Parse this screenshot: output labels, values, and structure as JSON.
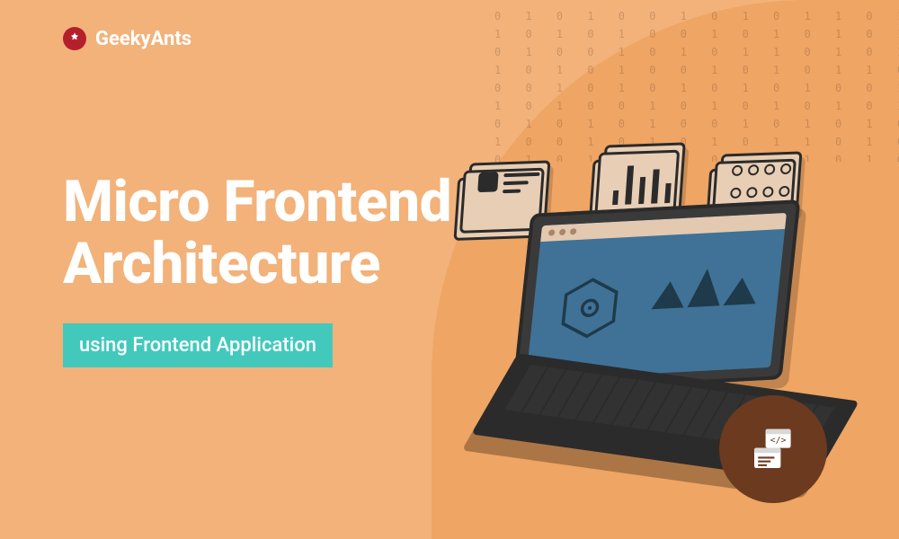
{
  "brand": {
    "name": "GeekyAnts"
  },
  "hero": {
    "title_line1": "Micro Frontend",
    "title_line2": "Architecture",
    "subtitle": "using Frontend Application"
  },
  "colors": {
    "bg_primary": "#f2b27a",
    "bg_secondary": "#efa563",
    "accent_pill": "#42c9bc",
    "brand_red": "#b3202b",
    "text_white": "#ffffff",
    "badge_brown": "#6b3a1f"
  },
  "decor": {
    "binary_pattern": "0 1 0 1 0 0 1 0 1 0 1 1 0 1 0 1 0 0 1 1 0 1\n1 0 1 0 1 0 0 1 0 1 0 1 0 1 0 0 1 0 1 0 1 0\n0 1 0 0 1 0 1 0 1 1 0 1 0 1 0 1 0 0 1 0 1 0\n1 0 1 0 1 0 0 1 0 1 0 1 1 0 1 0 1 0 0 1 0 1\n0 0 1 0 1 0 1 0 1 0 1 0 0 1 0 1 0 1 0 1 1 0\n1 0 1 0 0 1 0 1 0 1 0 1 0 1 0 0 1 0 1 0 1 0\n0 1 0 1 0 1 0 0 1 0 1 0 1 0 1 0 1 0 0 1 0 1\n1 0 0 1 0 1 0 1 0 1 1 0 1 0 1 0 0 1 0 1 0 1\n0 1 0 1 0 0 1 0 1 0 1 0 1 0 1 0 1 0 1 0 0 1"
  }
}
